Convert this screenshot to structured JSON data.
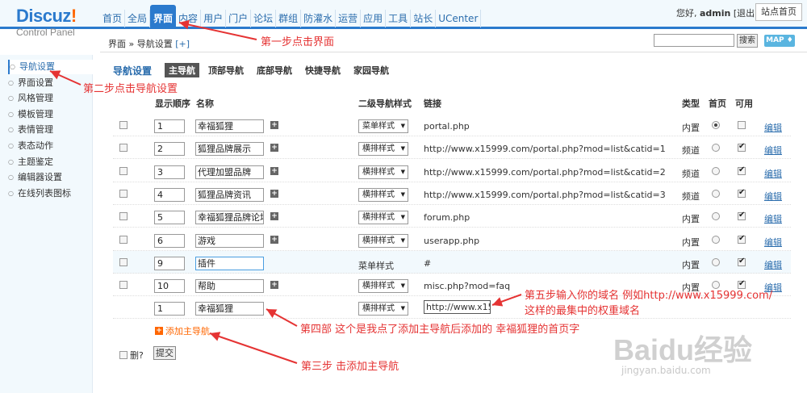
{
  "header": {
    "logo_main": "Discuz",
    "logo_mark": "!",
    "subtitle": "Control Panel",
    "nav": [
      "首页",
      "全局",
      "界面",
      "内容",
      "用户",
      "门户",
      "论坛",
      "群组",
      "防灌水",
      "运营",
      "应用",
      "工具",
      "站长",
      "UCenter"
    ],
    "active_nav": "界面",
    "greeting": "您好,",
    "username": "admin",
    "logout": "[退出]",
    "site_home": "站点首页"
  },
  "subbar": {
    "crumb_1": "界面",
    "sep": "»",
    "crumb_2": "导航设置",
    "add": "[+]",
    "search_button": "搜索",
    "map_button": "MAP ♦"
  },
  "sidebar": {
    "items": [
      "导航设置",
      "界面设置",
      "风格管理",
      "模板管理",
      "表情管理",
      "表态动作",
      "主题鉴定",
      "编辑器设置",
      "在线列表图标"
    ]
  },
  "tabs": {
    "title": "导航设置",
    "items": [
      "主导航",
      "顶部导航",
      "底部导航",
      "快捷导航",
      "家园导航"
    ]
  },
  "table": {
    "headers": {
      "order": "显示顺序",
      "name": "名称",
      "sub_style": "二级导航样式",
      "link": "链接",
      "type": "类型",
      "home": "首页",
      "enabled": "可用"
    },
    "rows": [
      {
        "order": "1",
        "name": "幸福狐狸",
        "style": "菜单样式",
        "link": "portal.php",
        "type": "内置",
        "home": true,
        "enabled": false,
        "edit": "编辑"
      },
      {
        "order": "2",
        "name": "狐狸品牌展示",
        "style": "横排样式",
        "link": "http://www.x15999.com/portal.php?mod=list&catid=1",
        "type": "频道",
        "home": false,
        "enabled": true,
        "edit": "编辑"
      },
      {
        "order": "3",
        "name": "代理加盟品牌",
        "style": "横排样式",
        "link": "http://www.x15999.com/portal.php?mod=list&catid=2",
        "type": "频道",
        "home": false,
        "enabled": true,
        "edit": "编辑"
      },
      {
        "order": "4",
        "name": "狐狸品牌资讯",
        "style": "横排样式",
        "link": "http://www.x15999.com/portal.php?mod=list&catid=3",
        "type": "频道",
        "home": false,
        "enabled": true,
        "edit": "编辑"
      },
      {
        "order": "5",
        "name": "幸福狐狸品牌论坛",
        "style": "横排样式",
        "link": "forum.php",
        "type": "内置",
        "home": false,
        "enabled": true,
        "edit": "编辑"
      },
      {
        "order": "6",
        "name": "游戏",
        "style": "横排样式",
        "link": "userapp.php",
        "type": "内置",
        "home": false,
        "enabled": true,
        "edit": "编辑"
      },
      {
        "order": "9",
        "name": "插件",
        "style": "菜单样式",
        "link": "#",
        "type": "内置",
        "home": false,
        "enabled": true,
        "edit": "编辑"
      },
      {
        "order": "10",
        "name": "帮助",
        "style": "横排样式",
        "link": "misc.php?mod=faq",
        "type": "内置",
        "home": false,
        "enabled": true,
        "edit": "编辑"
      }
    ],
    "new_row": {
      "order": "1",
      "name": "幸福狐狸",
      "style": "横排样式",
      "link_value": "http://www.x15"
    }
  },
  "add_main_nav": "添加主导航",
  "delete_label": "删?",
  "submit_label": "提交",
  "annotations": {
    "step1": "第一步点击界面",
    "step2": "第二步点击导航设置",
    "step3": "第三步 击添加主导航",
    "step4": "第四部 这个是我点了添加主导航后添加的 幸福狐狸的首页字",
    "step5_line1": "第五步输入你的域名 例如http://www.x15999.com/",
    "step5_line2": "这样的最集中的权重域名"
  },
  "watermark": {
    "brand": "Baidu经验",
    "url": "jingyan.baidu.com"
  },
  "colors": {
    "accent": "#2b7acd",
    "annotation": "#e53333",
    "add_link": "#ff6600"
  }
}
